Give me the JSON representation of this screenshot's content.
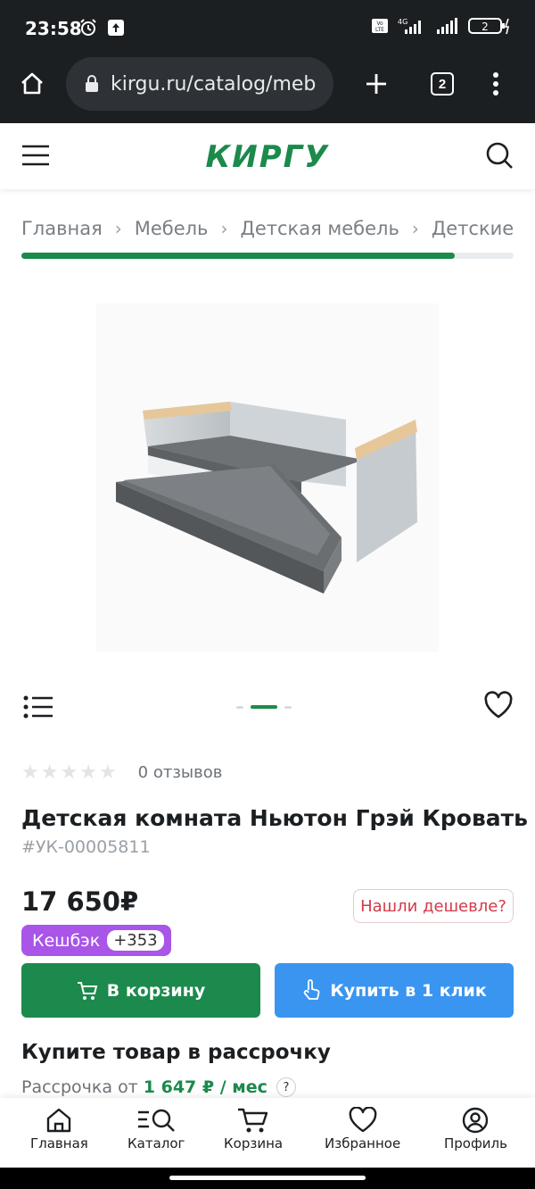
{
  "status_bar": {
    "time": "23:58",
    "battery": "2"
  },
  "browser": {
    "url": "kirgu.ru/catalog/meb",
    "tab_count": "2"
  },
  "header": {
    "logo": "КИРГУ"
  },
  "breadcrumbs": [
    "Главная",
    "Мебель",
    "Детская мебель",
    "Детские ко"
  ],
  "breadcrumb_scroll_fraction": 0.88,
  "gallery": {
    "slide_count": 3,
    "active_slide": 2
  },
  "product": {
    "rating_stars": 0,
    "reviews": "0 отзывов",
    "title": "Детская комната Ньютон Грэй Кровать",
    "sku": "#УК-00005811",
    "price": "17 650₽",
    "cheaper_label": "Нашли дешевле?",
    "cashback_label": "Кешбэк",
    "cashback_value": "+353",
    "cart_button": "В корзину",
    "one_click_button": "Купить в 1 клик"
  },
  "installment": {
    "title": "Купите товар в рассрочку",
    "prefix": "Рассрочка от",
    "amount": "1 647 ₽ / мес",
    "help": "?"
  },
  "bottom_nav": [
    {
      "label": "Главная",
      "icon": "home-icon"
    },
    {
      "label": "Каталог",
      "icon": "catalog-search-icon"
    },
    {
      "label": "Корзина",
      "icon": "cart-icon"
    },
    {
      "label": "Избранное",
      "icon": "heart-icon"
    },
    {
      "label": "Профиль",
      "icon": "profile-icon"
    }
  ],
  "colors": {
    "brand": "#1b8a4c",
    "accent_blue": "#3a95f0",
    "cashback": "#a855e8",
    "alert": "#d33a4a"
  }
}
